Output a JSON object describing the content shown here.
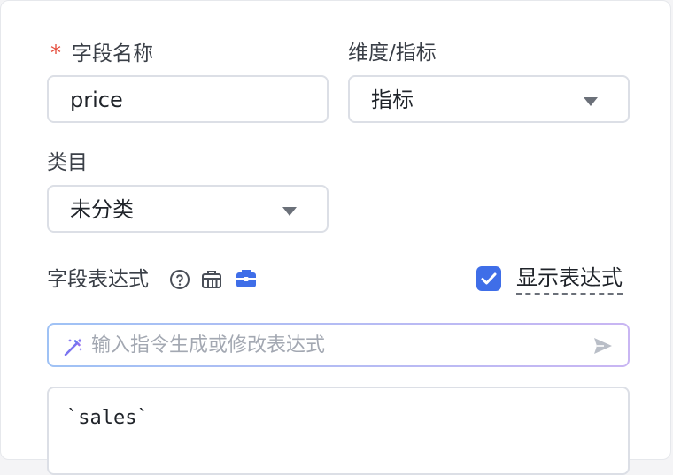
{
  "form": {
    "field_name_label": "字段名称",
    "field_name_value": "price",
    "dimension_label": "维度/指标",
    "dimension_value": "指标",
    "category_label": "类目",
    "category_value": "未分类",
    "expression_label": "字段表达式",
    "show_expression_label": "显示表达式",
    "show_expression_checked": true,
    "prompt_placeholder": "输入指令生成或修改表达式",
    "expression_code": "`sales`"
  },
  "icons": {
    "help": "question-circle-icon",
    "formula": "formula-icon",
    "toolbox": "toolbox-icon",
    "ai_wand": "magic-wand-icon",
    "send": "send-icon",
    "check": "check-icon",
    "caret": "chevron-down-icon"
  },
  "colors": {
    "required": "#e54d3d",
    "accent": "#3f6ee8",
    "toolbox": "#3f6ee8"
  }
}
